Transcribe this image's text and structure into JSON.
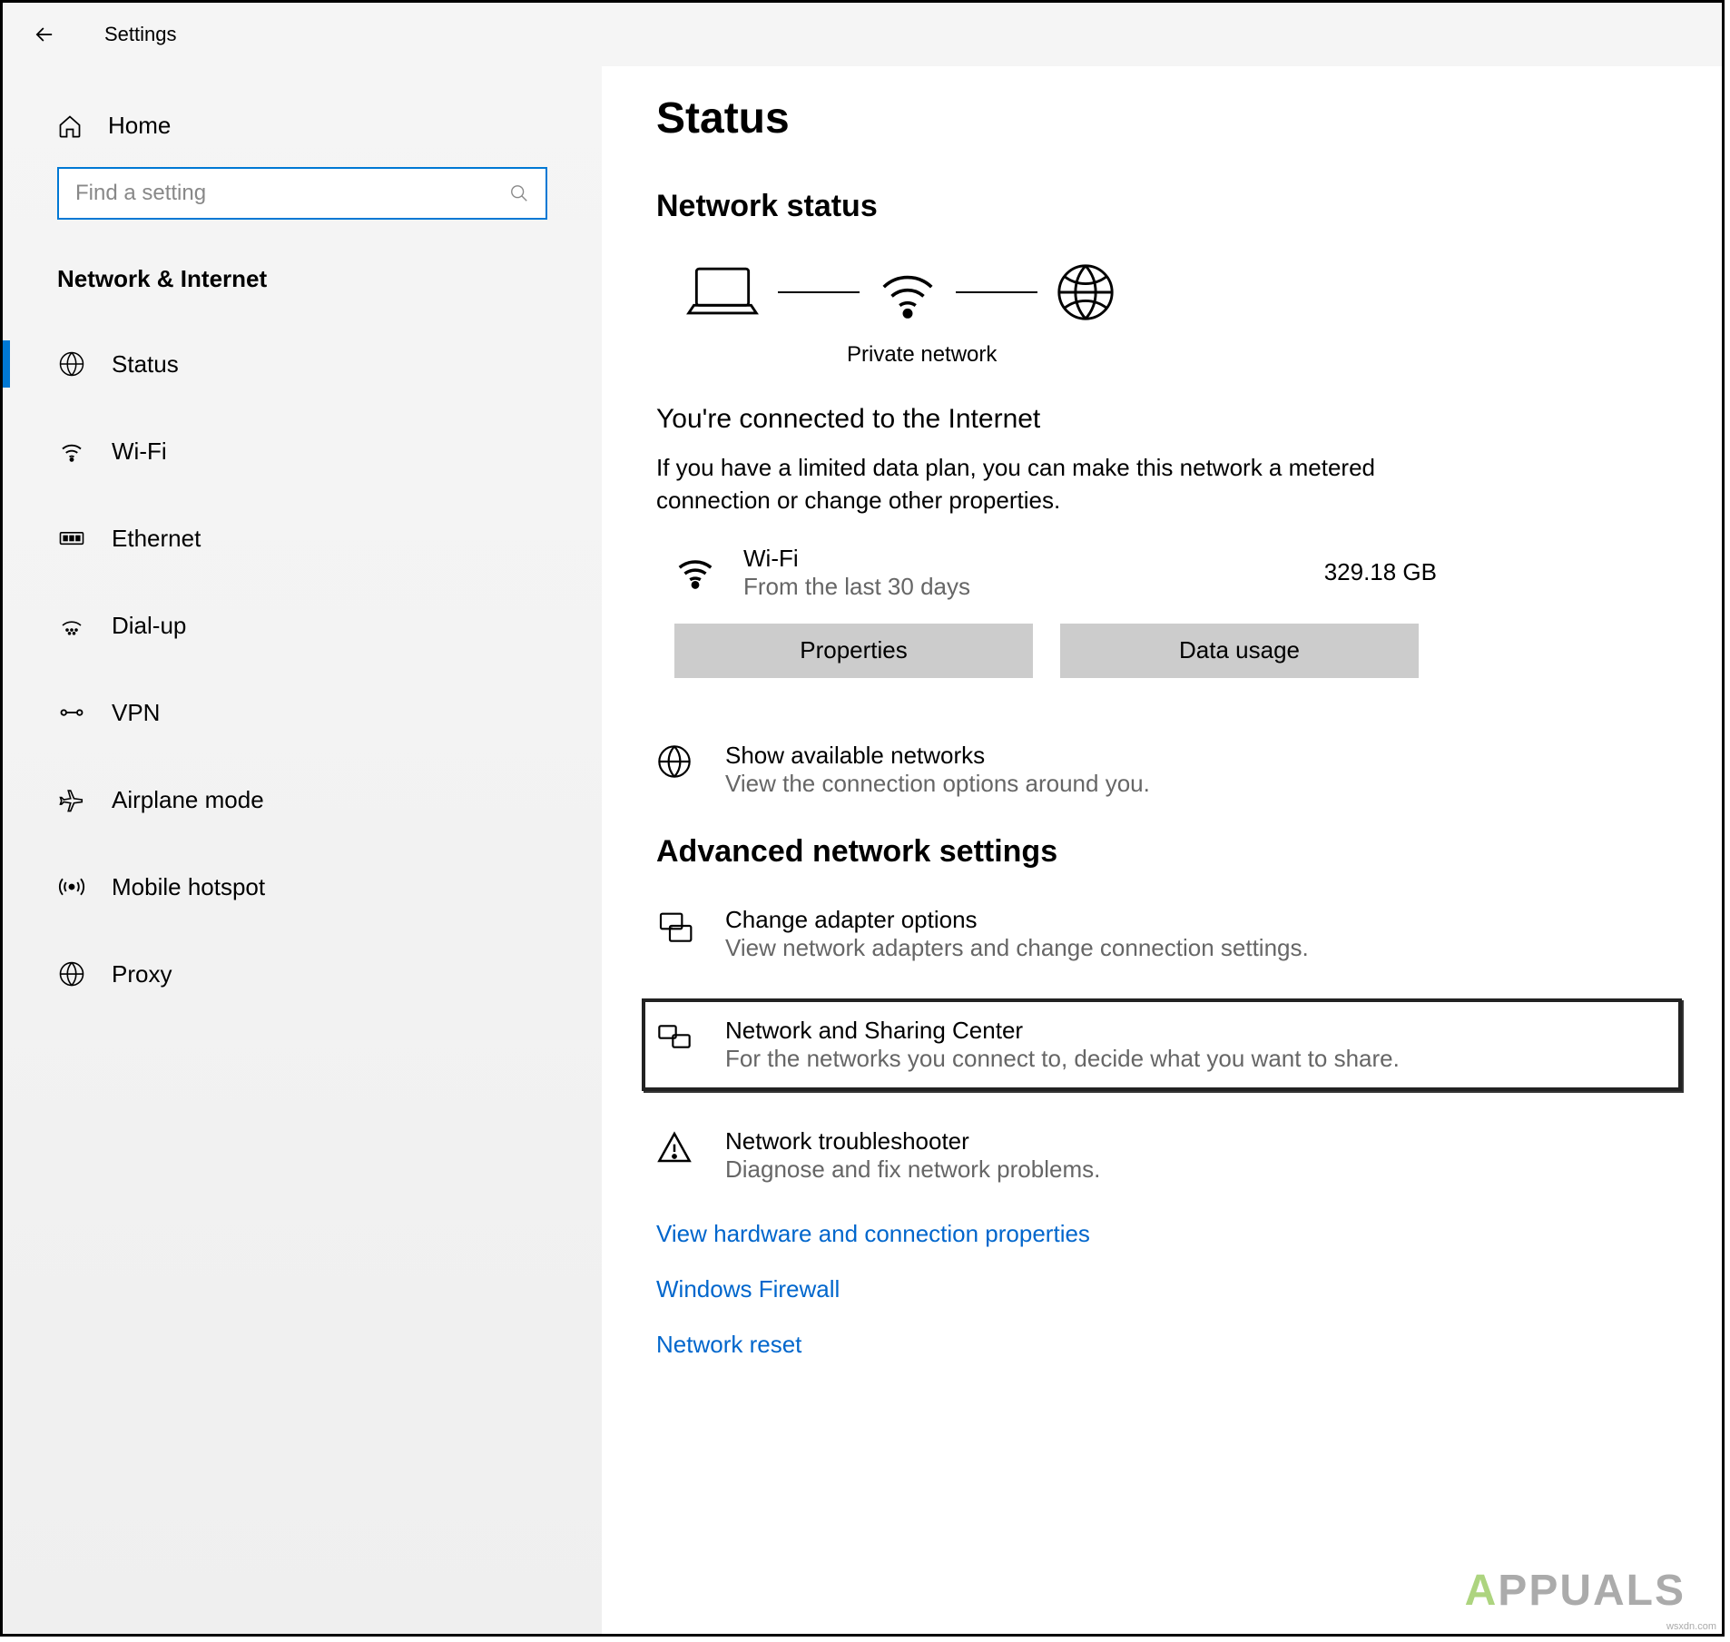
{
  "header": {
    "title": "Settings"
  },
  "sidebar": {
    "home_label": "Home",
    "search_placeholder": "Find a setting",
    "section_title": "Network & Internet",
    "items": [
      {
        "label": "Status",
        "icon": "globe-icon"
      },
      {
        "label": "Wi-Fi",
        "icon": "wifi-icon"
      },
      {
        "label": "Ethernet",
        "icon": "ethernet-icon"
      },
      {
        "label": "Dial-up",
        "icon": "dialup-icon"
      },
      {
        "label": "VPN",
        "icon": "vpn-icon"
      },
      {
        "label": "Airplane mode",
        "icon": "airplane-icon"
      },
      {
        "label": "Mobile hotspot",
        "icon": "hotspot-icon"
      },
      {
        "label": "Proxy",
        "icon": "proxy-icon"
      }
    ]
  },
  "main": {
    "heading": "Status",
    "network_status_heading": "Network status",
    "diagram_caption": "Private network",
    "connected_title": "You're connected to the Internet",
    "connected_desc": "If you have a limited data plan, you can make this network a metered connection or change other properties.",
    "wifi_name": "Wi-Fi",
    "wifi_sub": "From the last 30 days",
    "wifi_usage": "329.18 GB",
    "properties_btn": "Properties",
    "data_usage_btn": "Data usage",
    "show_networks_title": "Show available networks",
    "show_networks_sub": "View the connection options around you.",
    "advanced_heading": "Advanced network settings",
    "adapter_title": "Change adapter options",
    "adapter_sub": "View network adapters and change connection settings.",
    "sharing_title": "Network and Sharing Center",
    "sharing_sub": "For the networks you connect to, decide what you want to share.",
    "troubleshoot_title": "Network troubleshooter",
    "troubleshoot_sub": "Diagnose and fix network problems.",
    "link_hardware": "View hardware and connection properties",
    "link_firewall": "Windows Firewall",
    "link_reset": "Network reset"
  },
  "watermark": "APPUALS",
  "credit": "wsxdn.com"
}
